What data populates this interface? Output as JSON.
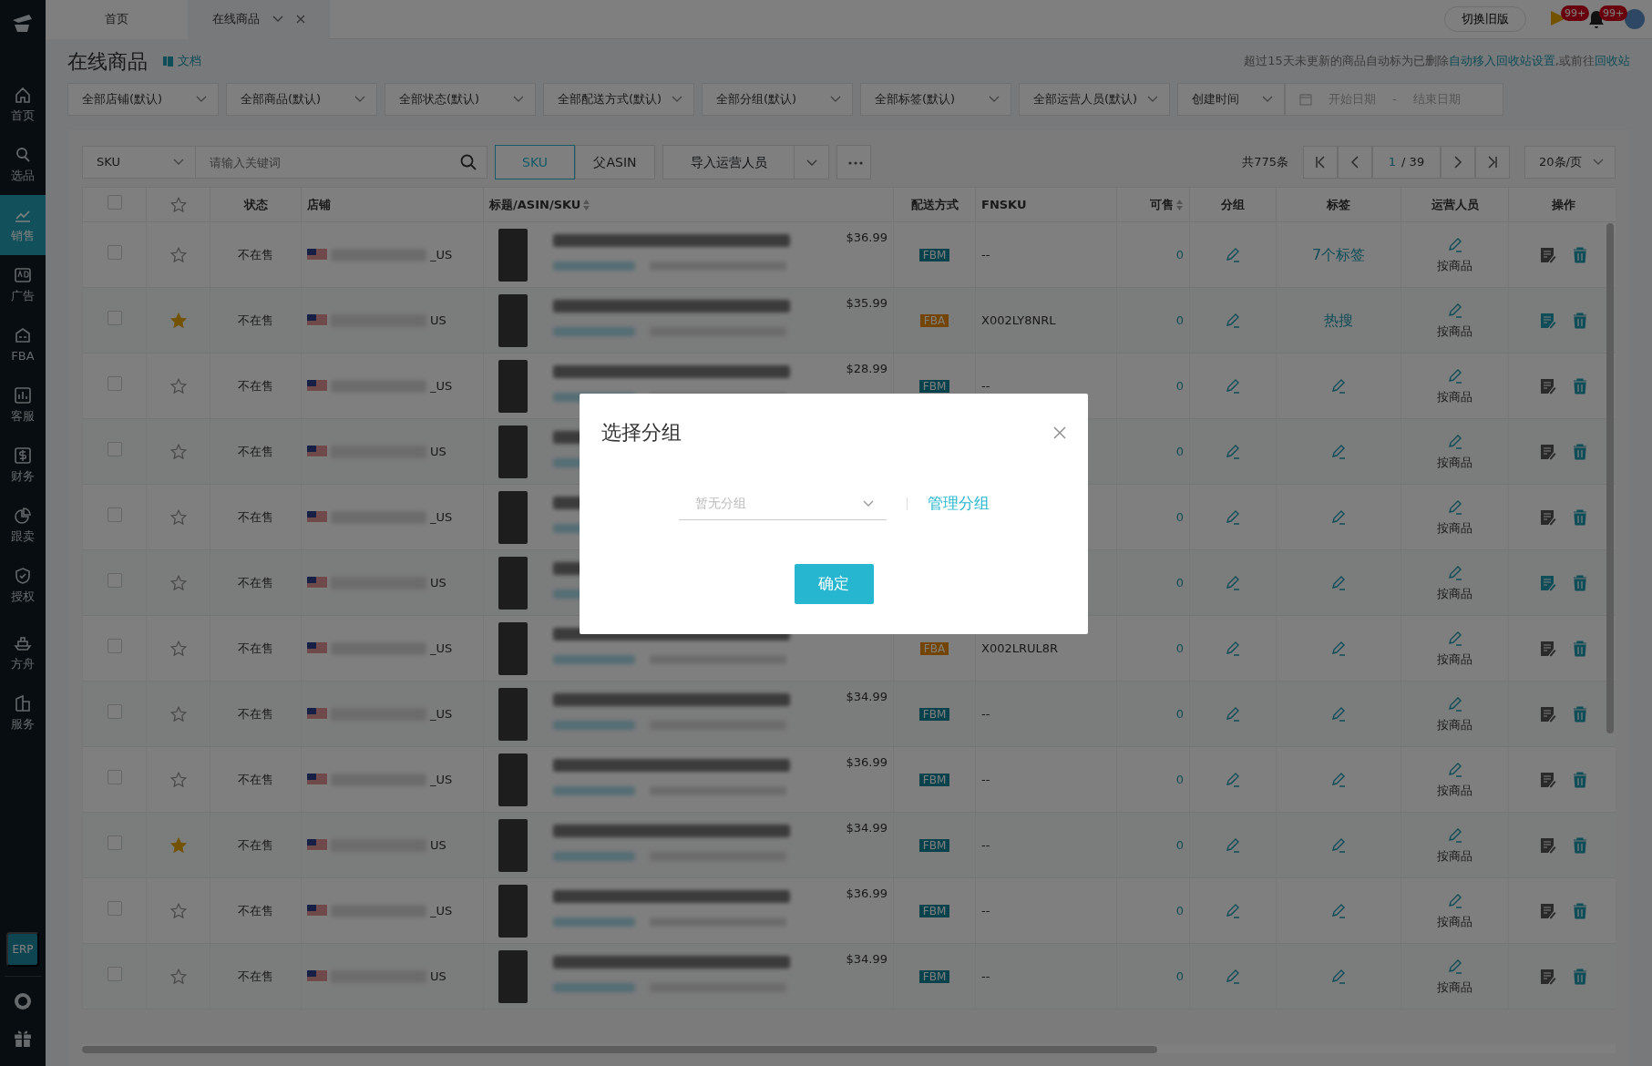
{
  "sidebar": {
    "items": [
      {
        "label": "首页",
        "kind": "home",
        "selected": false
      },
      {
        "label": "选品",
        "kind": "search",
        "selected": false
      },
      {
        "label": "销售",
        "kind": "chart",
        "selected": true
      },
      {
        "label": "广告",
        "kind": "ad",
        "selected": false
      },
      {
        "label": "FBA",
        "kind": "box",
        "selected": false
      },
      {
        "label": "客服",
        "kind": "bars",
        "selected": false
      },
      {
        "label": "财务",
        "kind": "dollar",
        "selected": false
      },
      {
        "label": "跟卖",
        "kind": "pie",
        "selected": false
      },
      {
        "label": "授权",
        "kind": "shield",
        "selected": false
      },
      {
        "label": "方舟",
        "kind": "ship",
        "selected": false
      },
      {
        "label": "服务",
        "kind": "building",
        "selected": false
      }
    ],
    "erp": "ERP"
  },
  "tabs": [
    {
      "label": "首页",
      "selected": false
    },
    {
      "label": "在线商品",
      "selected": true
    }
  ],
  "switch_button": "切换旧版",
  "notifications": [
    {
      "kind": "flag",
      "count": "99+"
    },
    {
      "kind": "bell",
      "count": "99+"
    }
  ],
  "page": {
    "title": "在线商品",
    "doc_link": "文档",
    "notice": "超过15天未更新的商品自动标为已删除",
    "notice_link": "自动移入回收站设置",
    "notice_middle": ",或前往",
    "notice_link2": "回收站"
  },
  "filters": [
    "全部店铺(默认)",
    "全部商品(默认)",
    "全部状态(默认)",
    "全部配送方式(默认)",
    "全部分组(默认)",
    "全部标签(默认)",
    "全部运营人员(默认)"
  ],
  "date_filter": {
    "type": "创建时间",
    "start_placeholder": "开始日期",
    "separator": "-",
    "end_placeholder": "结束日期"
  },
  "toolbar": {
    "search_type": "SKU",
    "search_placeholder": "请输入关键词",
    "toggles": [
      {
        "label": "SKU",
        "selected": true
      },
      {
        "label": "父ASIN",
        "selected": false
      }
    ],
    "import_button": "导入运营人员",
    "total": "共775条",
    "page": "1",
    "pages": "/ 39",
    "page_size": "20条/页"
  },
  "columns": [
    {
      "kind": "checkbox",
      "checked": false
    },
    {
      "kind": "star"
    },
    {
      "kind": "text",
      "label": "状态"
    },
    {
      "kind": "text",
      "label": "店铺"
    },
    {
      "kind": "text",
      "label": "标题/ASIN/SKU",
      "sortable": true
    },
    {
      "kind": "text",
      "label": "配送方式"
    },
    {
      "kind": "text",
      "label": "FNSKU"
    },
    {
      "kind": "text",
      "label": "可售",
      "sortable": true
    },
    {
      "kind": "text",
      "label": "分组"
    },
    {
      "kind": "text",
      "label": "标签"
    },
    {
      "kind": "text",
      "label": "运营人员"
    },
    {
      "kind": "text",
      "label": "操作"
    }
  ],
  "rows": [
    {
      "checked": false,
      "starred": false,
      "status": "不在售",
      "store_suffix": "_US",
      "price": "$36.99",
      "delivery": "FBM",
      "fnsku": "--",
      "available": "0",
      "tag": "7个标签",
      "operator": "按商品",
      "note_active": false
    },
    {
      "checked": false,
      "starred": true,
      "status": "不在售",
      "store_suffix": "US",
      "price": "$35.99",
      "delivery": "FBA",
      "fnsku": "X002LY8NRL",
      "available": "0",
      "tag": "热搜",
      "operator": "按商品",
      "note_active": true
    },
    {
      "checked": false,
      "starred": false,
      "status": "不在售",
      "store_suffix": "_US",
      "price": "$28.99",
      "delivery": "FBM",
      "fnsku": "--",
      "available": "0",
      "operator": "按商品",
      "note_active": false
    },
    {
      "checked": false,
      "starred": false,
      "status": "不在售",
      "store_suffix": "US",
      "available": "0",
      "operator": "按商品",
      "note_active": false
    },
    {
      "checked": false,
      "starred": false,
      "status": "不在售",
      "store_suffix": "_US",
      "available": "0",
      "operator": "按商品",
      "note_active": false
    },
    {
      "checked": false,
      "starred": false,
      "status": "不在售",
      "store_suffix": "US",
      "available": "0",
      "operator": "按商品",
      "note_active": true
    },
    {
      "checked": false,
      "starred": false,
      "status": "不在售",
      "store_suffix": "_US",
      "delivery": "FBA",
      "fnsku": "X002LRUL8R",
      "available": "0",
      "operator": "按商品",
      "note_active": false
    },
    {
      "checked": false,
      "starred": false,
      "status": "不在售",
      "store_suffix": "_US",
      "price": "$34.99",
      "delivery": "FBM",
      "fnsku": "--",
      "available": "0",
      "operator": "按商品",
      "note_active": false
    },
    {
      "checked": false,
      "starred": false,
      "status": "不在售",
      "store_suffix": "_US",
      "price": "$36.99",
      "delivery": "FBM",
      "fnsku": "--",
      "available": "0",
      "operator": "按商品",
      "note_active": false
    },
    {
      "checked": false,
      "starred": true,
      "status": "不在售",
      "store_suffix": "US",
      "price": "$34.99",
      "delivery": "FBM",
      "fnsku": "--",
      "available": "0",
      "operator": "按商品",
      "note_active": false
    },
    {
      "checked": false,
      "starred": false,
      "status": "不在售",
      "store_suffix": "_US",
      "price": "$36.99",
      "delivery": "FBM",
      "fnsku": "--",
      "available": "0",
      "operator": "按商品",
      "note_active": false
    },
    {
      "checked": false,
      "starred": false,
      "status": "不在售",
      "store_suffix": "US",
      "price": "$34.99",
      "delivery": "FBM",
      "fnsku": "--",
      "available": "0",
      "operator": "按商品",
      "note_active": false
    }
  ],
  "modal": {
    "title": "选择分组",
    "select_placeholder": "暂无分组",
    "manage_link": "管理分组",
    "ok_button": "确定"
  }
}
